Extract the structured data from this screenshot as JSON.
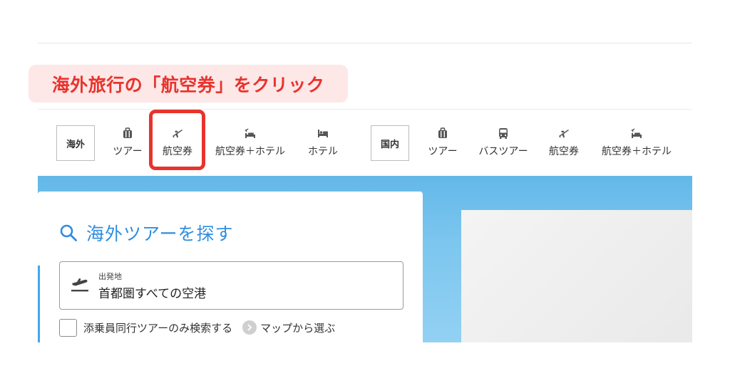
{
  "instruction": "海外旅行の「航空券」をクリック",
  "nav": {
    "overseas_label": "海外",
    "overseas_items": [
      {
        "label": "ツアー",
        "icon": "suitcase-icon"
      },
      {
        "label": "航空券",
        "icon": "airplane-icon"
      },
      {
        "label": "航空券＋ホテル",
        "icon": "plane-hotel-icon"
      },
      {
        "label": "ホテル",
        "icon": "bed-icon"
      }
    ],
    "domestic_label": "国内",
    "domestic_items": [
      {
        "label": "ツアー",
        "icon": "suitcase-icon"
      },
      {
        "label": "バスツアー",
        "icon": "bus-icon"
      },
      {
        "label": "航空券",
        "icon": "airplane-icon"
      },
      {
        "label": "航空券＋ホテル",
        "icon": "plane-hotel-icon"
      }
    ]
  },
  "search": {
    "title": "海外ツアーを探す",
    "departure_label": "出発地",
    "departure_value": "首都圏すべての空港",
    "escort_option": "添乗員同行ツアーのみ検索する",
    "map_link": "マップから選ぶ"
  },
  "colors": {
    "accent_red": "#e8332d",
    "link_blue": "#2f8ee0",
    "hero_blue": "#63b8e8"
  }
}
